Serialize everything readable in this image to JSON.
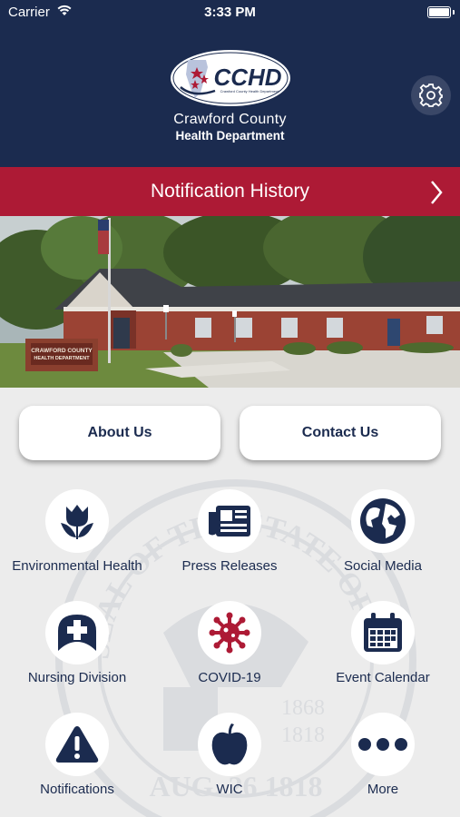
{
  "status_bar": {
    "carrier": "Carrier",
    "time": "3:33 PM"
  },
  "header": {
    "logo_text": "CCHD",
    "logo_subtext": "Crawford County Health Department",
    "org_line1": "Crawford County",
    "org_line2": "Health Department",
    "settings_icon": "gear-icon"
  },
  "notification_bar": {
    "label": "Notification History"
  },
  "photo": {
    "sign_line1": "CRAWFORD COUNTY",
    "sign_line2": "HEALTH DEPARTMENT"
  },
  "buttons": {
    "about": "About Us",
    "contact": "Contact Us"
  },
  "seal": {
    "text_top": "SEAL OF THE STATE OF ILLINOIS",
    "year1": "1868",
    "year2": "1818",
    "date": "AUG. 26 1818"
  },
  "tiles": [
    {
      "label": "Environmental Health",
      "icon": "tulip-icon"
    },
    {
      "label": "Press Releases",
      "icon": "newspaper-icon"
    },
    {
      "label": "Social Media",
      "icon": "globe-icon"
    },
    {
      "label": "Nursing Division",
      "icon": "nurse-cap-icon"
    },
    {
      "label": "COVID-19",
      "icon": "virus-icon"
    },
    {
      "label": "Event Calendar",
      "icon": "calendar-icon"
    },
    {
      "label": "Notifications",
      "icon": "warning-icon"
    },
    {
      "label": "WIC",
      "icon": "apple-icon"
    },
    {
      "label": "More",
      "icon": "more-icon"
    }
  ],
  "colors": {
    "navy": "#1b2b4f",
    "red": "#ad1a35",
    "background": "#ececec"
  }
}
